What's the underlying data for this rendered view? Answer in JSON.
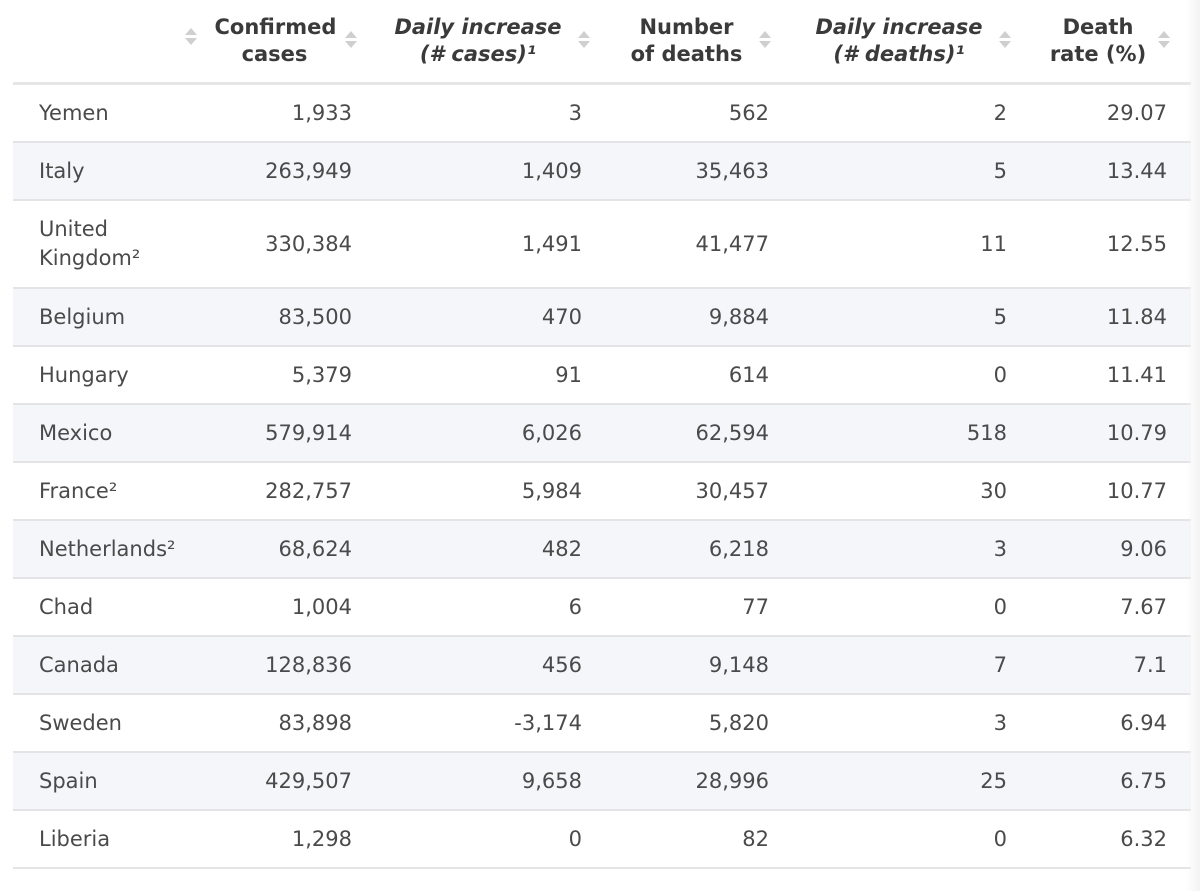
{
  "table": {
    "headers": [
      {
        "label": "",
        "italic": false
      },
      {
        "label": "Confirmed cases",
        "italic": false
      },
      {
        "label": "Daily increase (# cases)¹",
        "italic": true
      },
      {
        "label": "Number of deaths",
        "italic": false
      },
      {
        "label": "Daily increase (# deaths)¹",
        "italic": true
      },
      {
        "label": "Death rate (%)",
        "italic": false
      }
    ],
    "sort_icon": "sort-updown-icon",
    "rows": [
      {
        "country": "Yemen",
        "confirmed": "1,933",
        "daily_cases": "3",
        "deaths": "562",
        "daily_deaths": "2",
        "death_rate": "29.07"
      },
      {
        "country": "Italy",
        "confirmed": "263,949",
        "daily_cases": "1,409",
        "deaths": "35,463",
        "daily_deaths": "5",
        "death_rate": "13.44"
      },
      {
        "country": "United Kingdom²",
        "confirmed": "330,384",
        "daily_cases": "1,491",
        "deaths": "41,477",
        "daily_deaths": "11",
        "death_rate": "12.55"
      },
      {
        "country": "Belgium",
        "confirmed": "83,500",
        "daily_cases": "470",
        "deaths": "9,884",
        "daily_deaths": "5",
        "death_rate": "11.84"
      },
      {
        "country": "Hungary",
        "confirmed": "5,379",
        "daily_cases": "91",
        "deaths": "614",
        "daily_deaths": "0",
        "death_rate": "11.41"
      },
      {
        "country": "Mexico",
        "confirmed": "579,914",
        "daily_cases": "6,026",
        "deaths": "62,594",
        "daily_deaths": "518",
        "death_rate": "10.79"
      },
      {
        "country": "France²",
        "confirmed": "282,757",
        "daily_cases": "5,984",
        "deaths": "30,457",
        "daily_deaths": "30",
        "death_rate": "10.77"
      },
      {
        "country": "Netherlands²",
        "confirmed": "68,624",
        "daily_cases": "482",
        "deaths": "6,218",
        "daily_deaths": "3",
        "death_rate": "9.06"
      },
      {
        "country": "Chad",
        "confirmed": "1,004",
        "daily_cases": "6",
        "deaths": "77",
        "daily_deaths": "0",
        "death_rate": "7.67"
      },
      {
        "country": "Canada",
        "confirmed": "128,836",
        "daily_cases": "456",
        "deaths": "9,148",
        "daily_deaths": "7",
        "death_rate": "7.1"
      },
      {
        "country": "Sweden",
        "confirmed": "83,898",
        "daily_cases": "-3,174",
        "deaths": "5,820",
        "daily_deaths": "3",
        "death_rate": "6.94"
      },
      {
        "country": "Spain",
        "confirmed": "429,507",
        "daily_cases": "9,658",
        "deaths": "28,996",
        "daily_deaths": "25",
        "death_rate": "6.75"
      },
      {
        "country": "Liberia",
        "confirmed": "1,298",
        "daily_cases": "0",
        "deaths": "82",
        "daily_deaths": "0",
        "death_rate": "6.32"
      }
    ]
  }
}
